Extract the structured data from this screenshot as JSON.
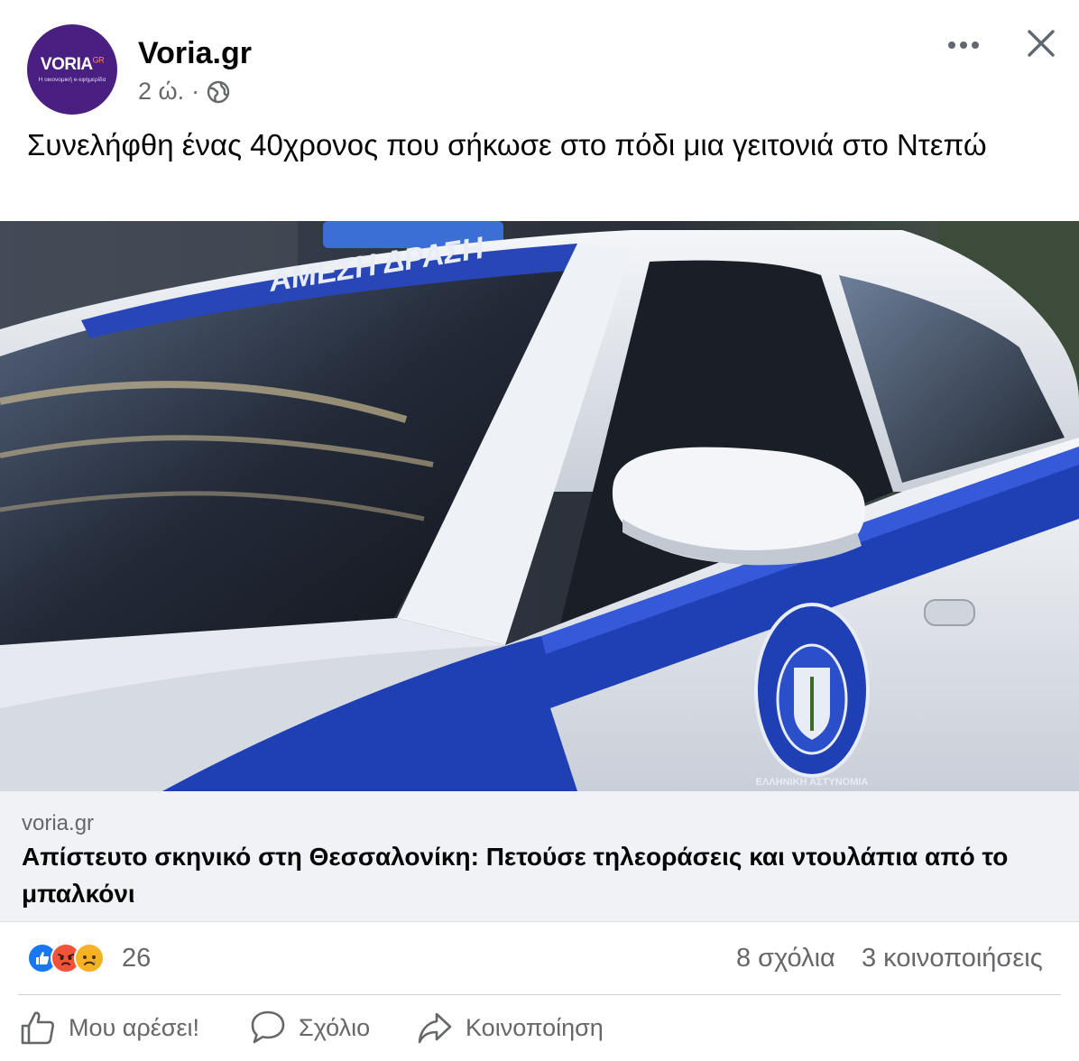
{
  "header": {
    "avatar_logo": "VORIA",
    "avatar_logo_suffix": "GR",
    "avatar_tagline": "Η οικονομική e-εφημερίδα",
    "page_name": "Voria.gr",
    "time_ago": "2 ώ.",
    "separator": "·",
    "audience_icon": "globe-icon",
    "more_icon": "more-options-icon",
    "close_icon": "close-icon"
  },
  "post": {
    "text": "Συνελήφθη ένας 40χρονος που σήκωσε στο πόδι μια γειτονιά στο Ντεπώ"
  },
  "link_preview": {
    "image_text_windshield": "ΑΜΕΣΗ ΔΡΑΣΗ",
    "image_text_emblem": "ΕΛΛΗΝΙΚΗ ΑΣΤΥΝΟΜΙΑ",
    "domain": "voria.gr",
    "title": "Απίστευτο σκηνικό στη Θεσσαλονίκη: Πετούσε τηλεοράσεις και ντουλάπια από το μπαλκόνι"
  },
  "engagement": {
    "reaction_types": [
      "like",
      "angry",
      "sad"
    ],
    "reaction_count": "26",
    "comments": "8 σχόλια",
    "shares": "3 κοινοποιήσεις"
  },
  "actions": {
    "like_label": "Μου αρέσει!",
    "comment_label": "Σχόλιο",
    "share_label": "Κοινοποίηση"
  },
  "colors": {
    "avatar_bg": "#4a1f82",
    "like_blue": "#1877f2",
    "angry_orange": "#f0533a",
    "sad_yellow": "#f7b125",
    "secondary_text": "#65676b",
    "police_blue": "#1f3fb4"
  }
}
